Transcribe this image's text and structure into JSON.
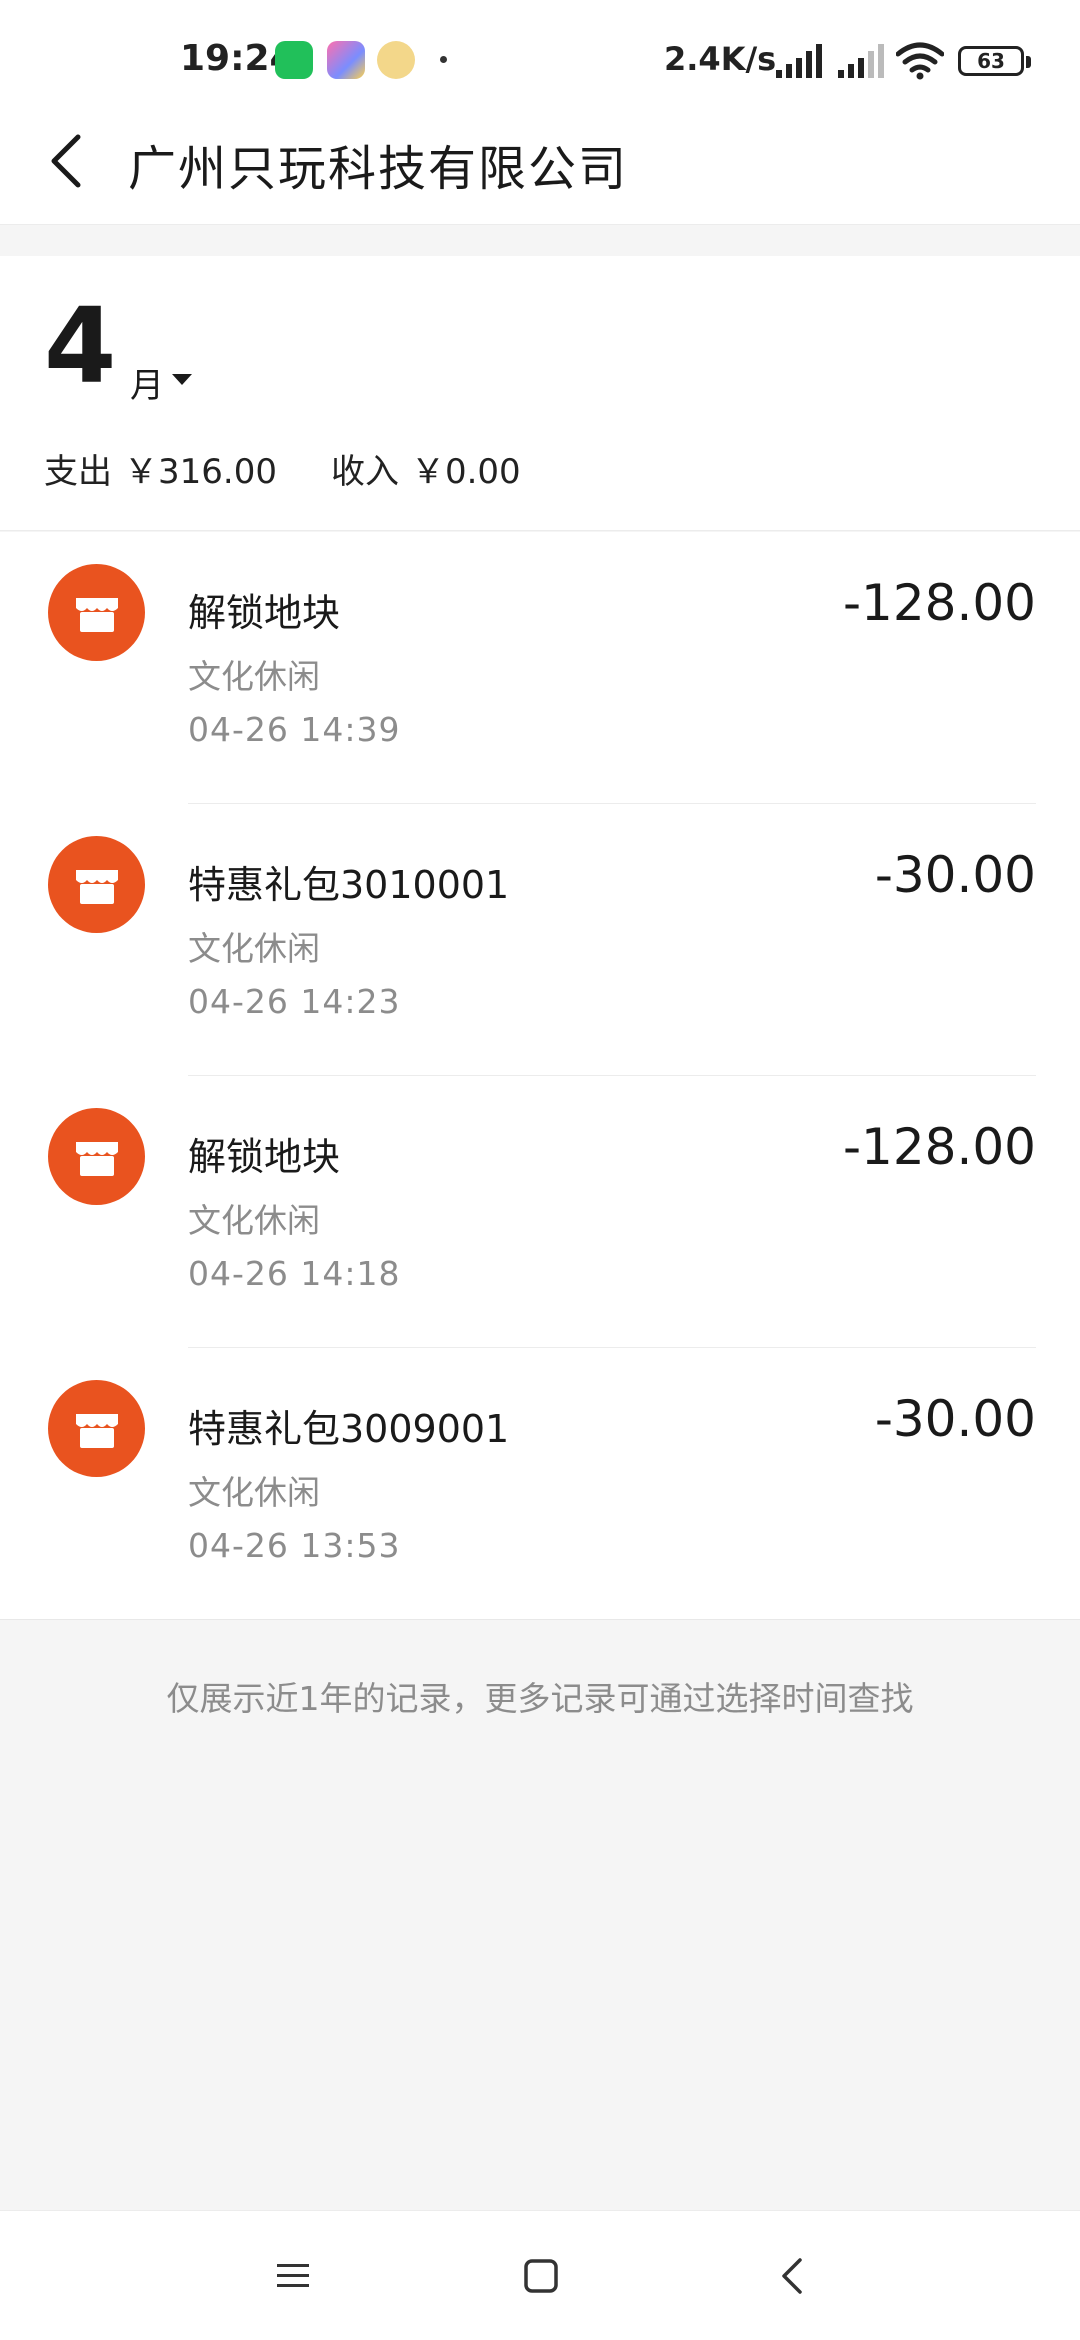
{
  "status_bar": {
    "time": "19:24",
    "speed": "2.4K/s",
    "battery": "63"
  },
  "header": {
    "title": "广州只玩科技有限公司"
  },
  "month": {
    "number": "4",
    "unit": "月",
    "expense_label": "支出",
    "expense_value": "￥316.00",
    "income_label": "收入",
    "income_value": "￥0.00"
  },
  "transactions": [
    {
      "name": "解锁地块",
      "category": "文化休闲",
      "time": "04-26  14:39",
      "amount": "-128.00"
    },
    {
      "name": "特惠礼包3010001",
      "category": "文化休闲",
      "time": "04-26  14:23",
      "amount": "-30.00"
    },
    {
      "name": "解锁地块",
      "category": "文化休闲",
      "time": "04-26  14:18",
      "amount": "-128.00"
    },
    {
      "name": "特惠礼包3009001",
      "category": "文化休闲",
      "time": "04-26  13:53",
      "amount": "-30.00"
    }
  ],
  "footer_note": "仅展示近1年的记录，更多记录可通过选择时间查找",
  "colors": {
    "merchant_icon": "#e9531f",
    "background": "#f5f5f5"
  },
  "icons": {
    "back": "chevron-left-icon",
    "merchant": "store-icon",
    "nav_menu": "menu-icon",
    "nav_home": "home-square-icon",
    "nav_back": "back-icon"
  }
}
